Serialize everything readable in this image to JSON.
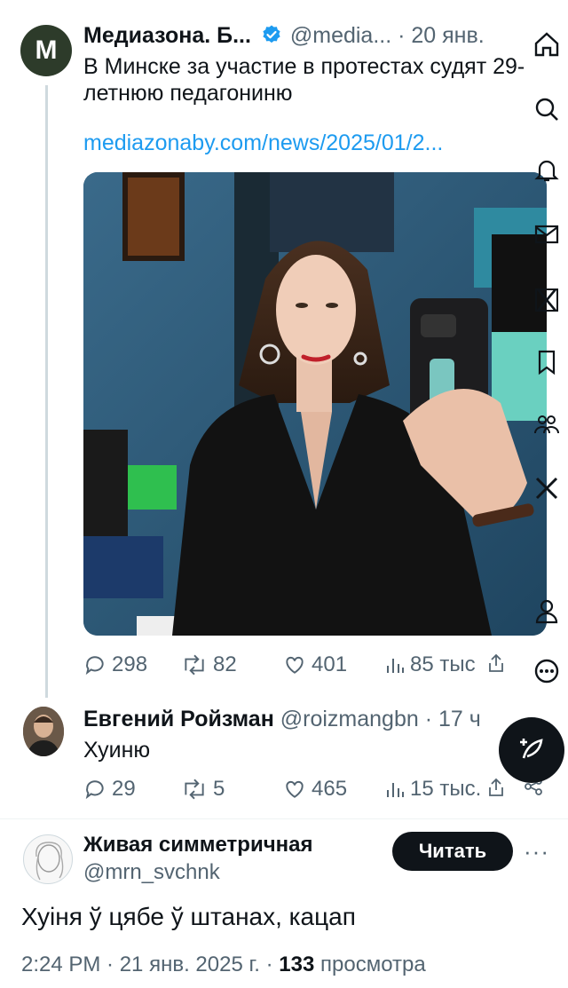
{
  "tweet1": {
    "avatar_letter": "M",
    "author": "Медиазона. Б...",
    "handle": "@media...",
    "time": "· 20 янв.",
    "text": "В Минске за участие в протестах судят 29-летнюю педагониню",
    "link": "mediazonaby.com/news/2025/01/2...",
    "stats": {
      "replies": "298",
      "retweets": "82",
      "likes": "401",
      "views": "85 тыс"
    }
  },
  "tweet2": {
    "author": "Евгений Ройзман",
    "handle": "@roizmangbn",
    "time": "· 17 ч",
    "text": "Хуиню",
    "stats": {
      "replies": "29",
      "retweets": "5",
      "likes": "465",
      "views": "15 тыс."
    }
  },
  "tweet3": {
    "author": "Живая симметричная",
    "handle": "@mrn_svchnk",
    "follow_label": "Читать",
    "more_label": "···",
    "text": "Хуіня ў цябе ў штанах, кацап",
    "meta_prefix": "2:24 PM · 21 янв. 2025 г. ·",
    "views_count": "133",
    "views_label": "просмотра"
  },
  "colors": {
    "accent": "#1d9bf0",
    "text": "#0f1419",
    "muted": "#536471",
    "verified": "#1d9bf0"
  },
  "icons": {
    "sidebar": [
      "home-icon",
      "search-icon",
      "notifications-icon",
      "messages-icon",
      "grok-icon",
      "bookmarks-icon",
      "communities-icon",
      "x-premium-icon",
      "profile-icon",
      "more-icon"
    ],
    "compose": "compose-post-icon"
  }
}
